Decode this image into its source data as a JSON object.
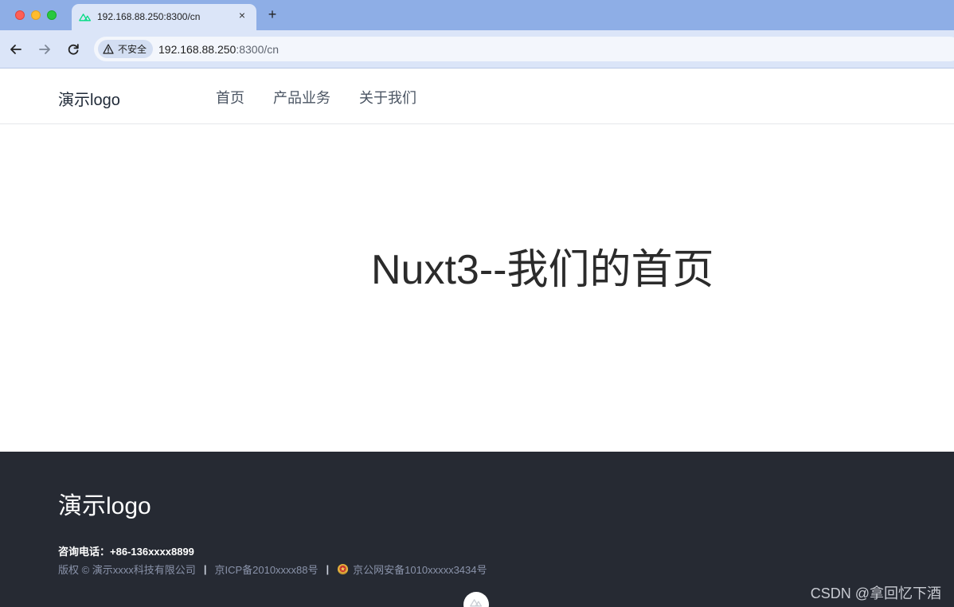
{
  "browser": {
    "tab_title": "192.168.88.250:8300/cn",
    "tab_close": "×",
    "new_tab": "+",
    "security_label": "不安全",
    "url_host": "192.168.88.250",
    "url_path": ":8300/cn",
    "favicon": "nuxt-icon"
  },
  "header": {
    "logo": "演示logo",
    "nav": [
      "首页",
      "产品业务",
      "关于我们"
    ]
  },
  "hero": {
    "title": "Nuxt3--我们的首页"
  },
  "footer": {
    "logo": "演示logo",
    "phone": "咨询电话：+86-136xxxx8899",
    "copyright": "版权 © 演示xxxx科技有限公司",
    "separator": "|",
    "icp": "京ICP备2010xxxx88号",
    "police": "京公网安备1010xxxxx3434号"
  },
  "watermark": "CSDN @拿回忆下酒",
  "colors": {
    "titlebar": "#8eaee6",
    "toolbar": "#dbe5f8",
    "footer_bg": "#262a33",
    "nuxt_green": "#00dc82"
  }
}
